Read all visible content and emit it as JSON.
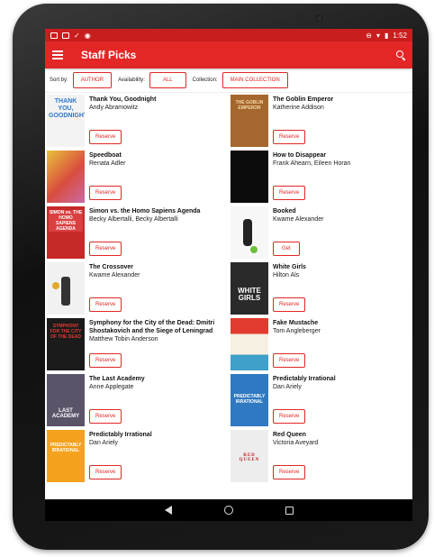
{
  "status_bar": {
    "time": "1:52"
  },
  "app_bar": {
    "title": "Staff Picks"
  },
  "filters": {
    "sort_label": "Sort by:",
    "sort_value": "AUTHOR",
    "availability_label": "Availability:",
    "availability_value": "ALL",
    "collection_label": "Collection:",
    "collection_value": "MAIN COLLECTION"
  },
  "books": [
    {
      "title": "Thank You, Goodnight",
      "author": "Andy Abramowitz",
      "action": "Reserve",
      "cover_text": "THANK YOU, GOODNIGHT"
    },
    {
      "title": "The Goblin Emperor",
      "author": "Katherine Addison",
      "action": "Reserve",
      "cover_text": "THE GOBLIN EMPEROR"
    },
    {
      "title": "Speedboat",
      "author": "Renata Adler",
      "action": "Reserve",
      "cover_text": ""
    },
    {
      "title": "How to Disappear",
      "author": "Frank Ahearn, Eileen Horan",
      "action": "Reserve",
      "cover_text": ""
    },
    {
      "title": "Simon vs. the Homo Sapiens Agenda",
      "author": "Becky Albertalli, Becky Albertalli",
      "action": "Reserve",
      "cover_text": "SIMON vs. THE HOMO SAPIENS AGENDA"
    },
    {
      "title": "Booked",
      "author": "Kwame Alexander",
      "action": "Get",
      "cover_text": ""
    },
    {
      "title": "The Crossover",
      "author": "Kwame Alexander",
      "action": "Reserve",
      "cover_text": ""
    },
    {
      "title": "White Girls",
      "author": "Hilton Als",
      "action": "Reserve",
      "cover_text": "WHITE GIRLS"
    },
    {
      "title": "Symphony for the City of the Dead: Dmitri Shostakovich and the Siege of Leningrad",
      "author": "Matthew Tobin Anderson",
      "action": "Reserve",
      "cover_text": "SYMPHONY FOR THE CITY OF THE DEAD"
    },
    {
      "title": "Fake Mustache",
      "author": "Tom Angleberger",
      "action": "Reserve",
      "cover_text": ""
    },
    {
      "title": "The Last Academy",
      "author": "Anne Applegate",
      "action": "Reserve",
      "cover_text": "LAST ACADEMY"
    },
    {
      "title": "Predictably Irrational",
      "author": "Dan Ariely",
      "action": "Reserve",
      "cover_text": "PREDICTABLY IRRATIONAL"
    },
    {
      "title": "Predictably Irrational",
      "author": "Dan Ariely",
      "action": "Reserve",
      "cover_text": "PREDICTABLY IRRATIONAL"
    },
    {
      "title": "Red Queen",
      "author": "Victoria Aveyard",
      "action": "Reserve",
      "cover_text": "RED QUEEN"
    }
  ],
  "colors": {
    "primary": "#e32626",
    "status": "#c81e1e"
  }
}
